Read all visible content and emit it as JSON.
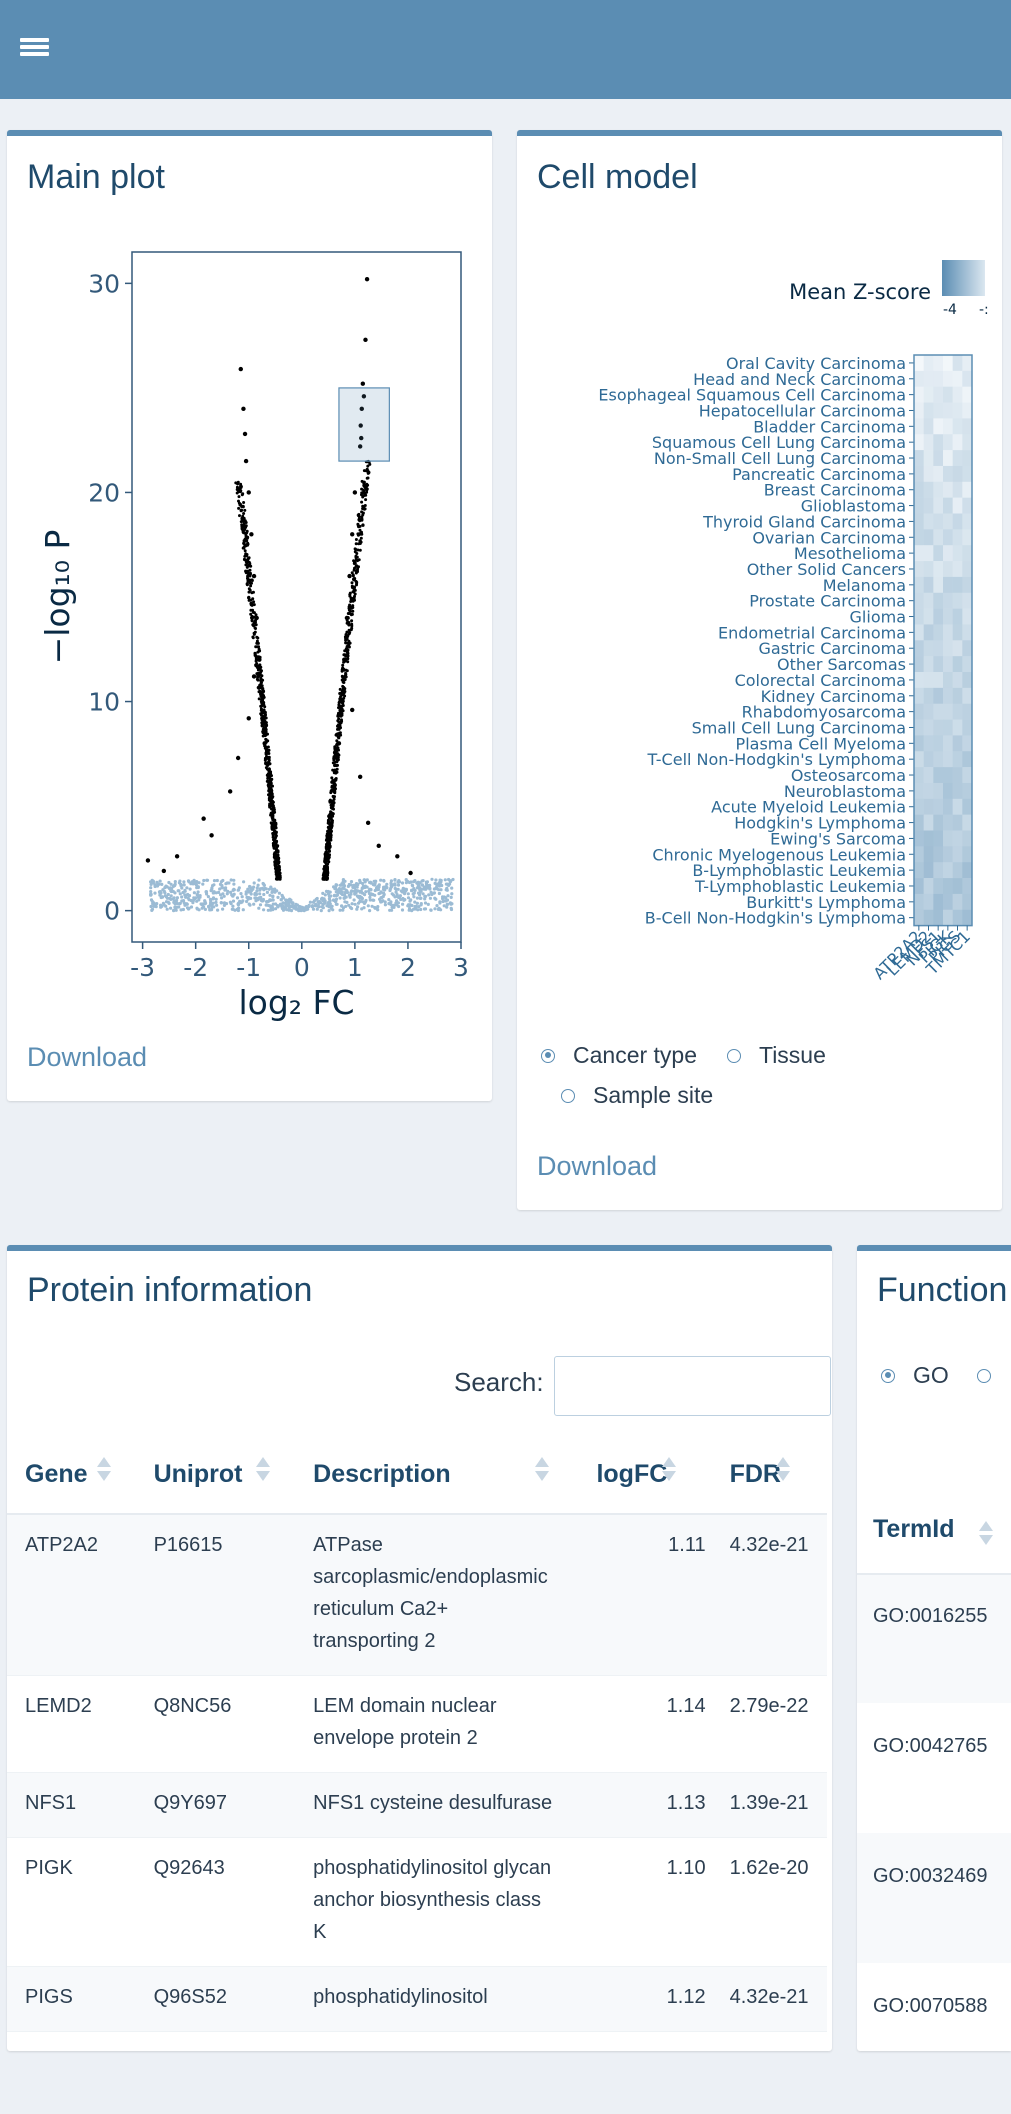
{
  "header": {
    "menu_icon": "hamburger-icon"
  },
  "main_plot": {
    "title": "Main plot",
    "download_label": "Download",
    "chart_data": {
      "type": "scatter",
      "title": "",
      "xlabel": "log₂ FC",
      "ylabel": "−log₁₀ P",
      "xlim": [
        -3.2,
        3.0
      ],
      "ylim": [
        -1.5,
        31.5
      ],
      "xticks": [
        "-3",
        "-2",
        "-1",
        "0",
        "1",
        "2",
        "3"
      ],
      "yticks": [
        "0",
        "10",
        "20",
        "30"
      ],
      "grid": false,
      "colors": {
        "significant": "#000000",
        "not_significant": "#9bbbd4",
        "highlight_box": "#5b8db3"
      },
      "highlight_region": {
        "x": [
          0.7,
          1.65
        ],
        "y": [
          21.5,
          25.0
        ]
      },
      "series": [
        {
          "values": [
            [
              1.23,
              30.2
            ],
            [
              1.2,
              27.3
            ],
            [
              1.15,
              25.2
            ],
            [
              1.17,
              24.6
            ],
            [
              1.13,
              24.0
            ],
            [
              1.11,
              23.2
            ],
            [
              1.12,
              22.6
            ],
            [
              1.1,
              22.2
            ],
            [
              -1.15,
              25.9
            ],
            [
              -1.1,
              24.0
            ],
            [
              -1.07,
              22.8
            ],
            [
              -1.05,
              21.5
            ],
            [
              -1.0,
              20.0
            ],
            [
              -0.95,
              18.0
            ],
            [
              -0.9,
              16.0
            ],
            [
              -0.85,
              14.0
            ],
            [
              -0.8,
              12.0
            ],
            [
              -0.75,
              10.0
            ],
            [
              -0.7,
              8.0
            ],
            [
              -0.62,
              6.0
            ],
            [
              -0.55,
              4.0
            ],
            [
              -0.45,
              2.5
            ],
            [
              0.85,
              14.0
            ],
            [
              0.9,
              16.0
            ],
            [
              0.95,
              18.0
            ],
            [
              1.0,
              20.0
            ],
            [
              0.8,
              12.0
            ],
            [
              0.75,
              10.0
            ],
            [
              0.7,
              8.0
            ],
            [
              0.62,
              6.0
            ],
            [
              0.55,
              4.0
            ],
            [
              0.45,
              2.5
            ],
            [
              -2.9,
              2.4
            ],
            [
              -2.6,
              1.9
            ],
            [
              -2.35,
              2.6
            ],
            [
              -1.85,
              4.4
            ],
            [
              -1.7,
              3.6
            ],
            [
              -1.35,
              5.7
            ],
            [
              -1.2,
              7.3
            ],
            [
              -1.0,
              9.2
            ],
            [
              -0.9,
              11.2
            ],
            [
              1.8,
              2.6
            ],
            [
              2.05,
              1.8
            ],
            [
              1.25,
              4.2
            ],
            [
              1.45,
              3.1
            ],
            [
              1.1,
              6.4
            ],
            [
              0.95,
              9.6
            ]
          ]
        },
        {
          "values": [
            [
              -2.8,
              1.4
            ],
            [
              -2.4,
              1.2
            ],
            [
              -2.0,
              1.3
            ],
            [
              -1.8,
              0.9
            ],
            [
              -1.5,
              1.1
            ],
            [
              -1.3,
              0.7
            ],
            [
              -1.0,
              0.9
            ],
            [
              -0.8,
              0.6
            ],
            [
              -0.6,
              0.5
            ],
            [
              -0.4,
              0.3
            ],
            [
              -0.2,
              0.2
            ],
            [
              0.0,
              0.1
            ],
            [
              0.2,
              0.2
            ],
            [
              0.4,
              0.3
            ],
            [
              0.6,
              0.5
            ],
            [
              0.8,
              0.6
            ],
            [
              1.0,
              0.8
            ],
            [
              1.3,
              1.0
            ],
            [
              1.6,
              1.1
            ],
            [
              1.9,
              0.9
            ],
            [
              2.2,
              1.2
            ],
            [
              2.6,
              1.3
            ],
            [
              2.8,
              1.4
            ]
          ]
        }
      ]
    }
  },
  "cell_model": {
    "title": "Cell model",
    "legend_title": "Mean Z-score",
    "legend_ticks": [
      "-4",
      "-:"
    ],
    "rows": [
      "Oral Cavity Carcinoma",
      "Head and Neck Carcinoma",
      "Esophageal Squamous Cell Carcinoma",
      "Hepatocellular Carcinoma",
      "Bladder Carcinoma",
      "Squamous Cell Lung Carcinoma",
      "Non-Small Cell Lung Carcinoma",
      "Pancreatic Carcinoma",
      "Breast Carcinoma",
      "Glioblastoma",
      "Thyroid Gland Carcinoma",
      "Ovarian Carcinoma",
      "Mesothelioma",
      "Other Solid Cancers",
      "Melanoma",
      "Prostate Carcinoma",
      "Glioma",
      "Endometrial Carcinoma",
      "Gastric Carcinoma",
      "Other Sarcomas",
      "Colorectal Carcinoma",
      "Kidney Carcinoma",
      "Rhabdomyosarcoma",
      "Small Cell Lung Carcinoma",
      "Plasma Cell Myeloma",
      "T-Cell Non-Hodgkin's Lymphoma",
      "Osteosarcoma",
      "Neuroblastoma",
      "Acute Myeloid Leukemia",
      "Hodgkin's Lymphoma",
      "Ewing's Sarcoma",
      "Chronic Myelogenous Leukemia",
      "B-Lymphoblastic Leukemia",
      "T-Lymphoblastic Leukemia",
      "Burkitt's Lymphoma",
      "B-Cell Non-Hodgkin's Lymphoma"
    ],
    "columns": [
      "ATP2A2",
      "LEMD2",
      "NFS1",
      "PIGK",
      "PIGS",
      "TMTC1"
    ],
    "col_labels_shown": [
      "ATP2A2",
      "LEMD2",
      "NFS1",
      "PIGK",
      "PIGS",
      "TMTC1"
    ],
    "heatmap_colors": {
      "low": "#f4f8fb",
      "high": "#8fb2cc",
      "border": "#5b8db3"
    },
    "radio_options": [
      {
        "label": "Cancer type",
        "selected": true
      },
      {
        "label": "Tissue",
        "selected": false
      },
      {
        "label": "Sample site",
        "selected": false
      }
    ],
    "download_label": "Download"
  },
  "protein_info": {
    "title": "Protein information",
    "search_label": "Search:",
    "search_value": "",
    "columns": [
      "Gene",
      "Uniprot",
      "Description",
      "logFC",
      "FDR"
    ],
    "rows": [
      {
        "gene": "ATP2A2",
        "uniprot": "P16615",
        "description": "ATPase sarcoplasmic/endoplasmic reticulum Ca2+ transporting 2",
        "logfc": "1.11",
        "fdr": "4.32e-21"
      },
      {
        "gene": "LEMD2",
        "uniprot": "Q8NC56",
        "description": "LEM domain nuclear envelope protein 2",
        "logfc": "1.14",
        "fdr": "2.79e-22"
      },
      {
        "gene": "NFS1",
        "uniprot": "Q9Y697",
        "description": "NFS1 cysteine desulfurase",
        "logfc": "1.13",
        "fdr": "1.39e-21"
      },
      {
        "gene": "PIGK",
        "uniprot": "Q92643",
        "description": "phosphatidylinositol glycan anchor biosynthesis class K",
        "logfc": "1.10",
        "fdr": "1.62e-20"
      },
      {
        "gene": "PIGS",
        "uniprot": "Q96S52",
        "description": "phosphatidylinositol",
        "logfc": "1.12",
        "fdr": "4.32e-21"
      }
    ]
  },
  "function": {
    "title": "Function",
    "radio_label": "GO",
    "column_header": "TermId",
    "terms": [
      "GO:0016255",
      "GO:0042765",
      "GO:0032469",
      "GO:0070588"
    ]
  }
}
